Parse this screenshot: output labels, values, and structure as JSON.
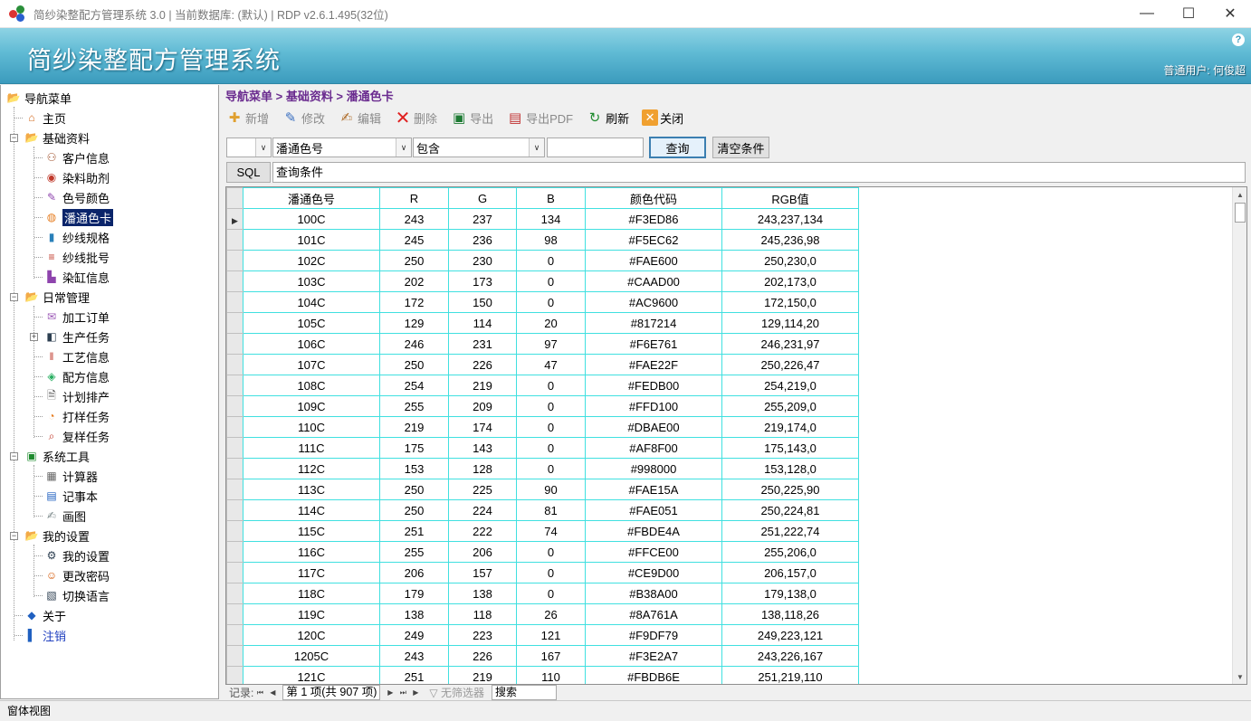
{
  "window": {
    "title": "简纱染整配方管理系统 3.0 | 当前数据库: (默认) | RDP v2.6.1.495(32位)"
  },
  "banner": {
    "system_title": "简纱染整配方管理系统",
    "help": "?",
    "user": "普通用户: 何俊超"
  },
  "sidebar": {
    "root": "导航菜单",
    "home": "主页",
    "basic": {
      "label": "基础资料",
      "items": [
        "客户信息",
        "染料助剂",
        "色号颜色",
        "潘通色卡",
        "纱线规格",
        "纱线批号",
        "染缸信息"
      ]
    },
    "daily": {
      "label": "日常管理",
      "items": [
        "加工订单",
        "生产任务",
        "工艺信息",
        "配方信息",
        "计划排产",
        "打样任务",
        "复样任务"
      ]
    },
    "tools": {
      "label": "系统工具",
      "items": [
        "计算器",
        "记事本",
        "画图"
      ]
    },
    "settings": {
      "label": "我的设置",
      "items": [
        "我的设置",
        "更改密码",
        "切换语言"
      ]
    },
    "about": "关于",
    "logout": "注销"
  },
  "breadcrumb": "导航菜单 > 基础资料 > 潘通色卡",
  "toolbar": {
    "add": "新增",
    "modify": "修改",
    "edit": "编辑",
    "delete": "删除",
    "export": "导出",
    "export_pdf": "导出PDF",
    "refresh": "刷新",
    "close": "关闭"
  },
  "filter": {
    "field": "潘通色号",
    "operator": "包含",
    "value": "",
    "query_button": "查询",
    "clear_button": "清空条件",
    "sql_button": "SQL",
    "condition_text": "查询条件"
  },
  "grid": {
    "columns": [
      "潘通色号",
      "R",
      "G",
      "B",
      "颜色代码",
      "RGB值"
    ],
    "rows": [
      [
        "100C",
        "243",
        "237",
        "134",
        "#F3ED86",
        "243,237,134"
      ],
      [
        "101C",
        "245",
        "236",
        "98",
        "#F5EC62",
        "245,236,98"
      ],
      [
        "102C",
        "250",
        "230",
        "0",
        "#FAE600",
        "250,230,0"
      ],
      [
        "103C",
        "202",
        "173",
        "0",
        "#CAAD00",
        "202,173,0"
      ],
      [
        "104C",
        "172",
        "150",
        "0",
        "#AC9600",
        "172,150,0"
      ],
      [
        "105C",
        "129",
        "114",
        "20",
        "#817214",
        "129,114,20"
      ],
      [
        "106C",
        "246",
        "231",
        "97",
        "#F6E761",
        "246,231,97"
      ],
      [
        "107C",
        "250",
        "226",
        "47",
        "#FAE22F",
        "250,226,47"
      ],
      [
        "108C",
        "254",
        "219",
        "0",
        "#FEDB00",
        "254,219,0"
      ],
      [
        "109C",
        "255",
        "209",
        "0",
        "#FFD100",
        "255,209,0"
      ],
      [
        "110C",
        "219",
        "174",
        "0",
        "#DBAE00",
        "219,174,0"
      ],
      [
        "111C",
        "175",
        "143",
        "0",
        "#AF8F00",
        "175,143,0"
      ],
      [
        "112C",
        "153",
        "128",
        "0",
        "#998000",
        "153,128,0"
      ],
      [
        "113C",
        "250",
        "225",
        "90",
        "#FAE15A",
        "250,225,90"
      ],
      [
        "114C",
        "250",
        "224",
        "81",
        "#FAE051",
        "250,224,81"
      ],
      [
        "115C",
        "251",
        "222",
        "74",
        "#FBDE4A",
        "251,222,74"
      ],
      [
        "116C",
        "255",
        "206",
        "0",
        "#FFCE00",
        "255,206,0"
      ],
      [
        "117C",
        "206",
        "157",
        "0",
        "#CE9D00",
        "206,157,0"
      ],
      [
        "118C",
        "179",
        "138",
        "0",
        "#B38A00",
        "179,138,0"
      ],
      [
        "119C",
        "138",
        "118",
        "26",
        "#8A761A",
        "138,118,26"
      ],
      [
        "120C",
        "249",
        "223",
        "121",
        "#F9DF79",
        "249,223,121"
      ],
      [
        "1205C",
        "243",
        "226",
        "167",
        "#F3E2A7",
        "243,226,167"
      ],
      [
        "121C",
        "251",
        "219",
        "110",
        "#FBDB6E",
        "251,219,110"
      ]
    ]
  },
  "navigator": {
    "label": "记录:",
    "page_info": "第 1 项(共 907 项)",
    "no_filter": "无筛选器",
    "search": "搜索"
  },
  "statusbar": {
    "text": "窗体视图"
  }
}
